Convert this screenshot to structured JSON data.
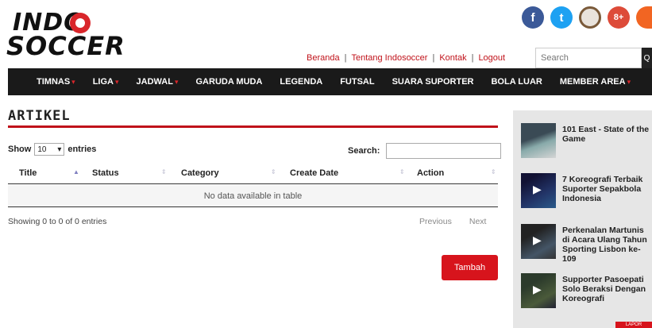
{
  "logo": {
    "line1": "INDO",
    "line2": "SOCCER"
  },
  "social": [
    "facebook-icon",
    "twitter-icon",
    "instagram-icon",
    "google-plus-icon",
    "rss-icon"
  ],
  "social_glyphs": {
    "fb": "f",
    "tw": "t",
    "ig": "",
    "gp": "8+",
    "rss": ""
  },
  "topnav": {
    "items": [
      "Beranda",
      "Tentang Indosoccer",
      "Kontak",
      "Logout"
    ],
    "sep": "|"
  },
  "search_top": {
    "placeholder": "Search",
    "button": "Q"
  },
  "mainnav": {
    "items": [
      {
        "label": "TIMNAS",
        "dropdown": true
      },
      {
        "label": "LIGA",
        "dropdown": true
      },
      {
        "label": "JADWAL",
        "dropdown": true
      },
      {
        "label": "GARUDA MUDA",
        "dropdown": false
      },
      {
        "label": "LEGENDA",
        "dropdown": false
      },
      {
        "label": "FUTSAL",
        "dropdown": false
      },
      {
        "label": "SUARA SUPORTER",
        "dropdown": false
      },
      {
        "label": "BOLA LUAR",
        "dropdown": false
      },
      {
        "label": "MEMBER AREA",
        "dropdown": true
      }
    ]
  },
  "article": {
    "title": "ARTIKEL",
    "show_label": "Show",
    "show_value": "10",
    "entries_label": "entries",
    "search_label": "Search:",
    "columns": [
      "Title",
      "Status",
      "Category",
      "Create Date",
      "Action"
    ],
    "empty_text": "No data available in table",
    "info": "Showing 0 to 0 of 0 entries",
    "prev": "Previous",
    "next": "Next",
    "add_button": "Tambah"
  },
  "sidebar": {
    "items": [
      "101 East - State of the Game",
      "7 Koreografi Terbaik Suporter Sepakbola Indonesia",
      "Perkenalan Martunis di Acara Ulang Tahun Sporting Lisbon ke-109",
      "Supporter Pasoepati Solo Beraksi Dengan Koreografi"
    ]
  },
  "corner_tag": "LAPOR",
  "colors": {
    "accent": "#d7141c",
    "nav_bg": "#1a1a1a",
    "sidebar_bg": "#e6e6e6"
  }
}
